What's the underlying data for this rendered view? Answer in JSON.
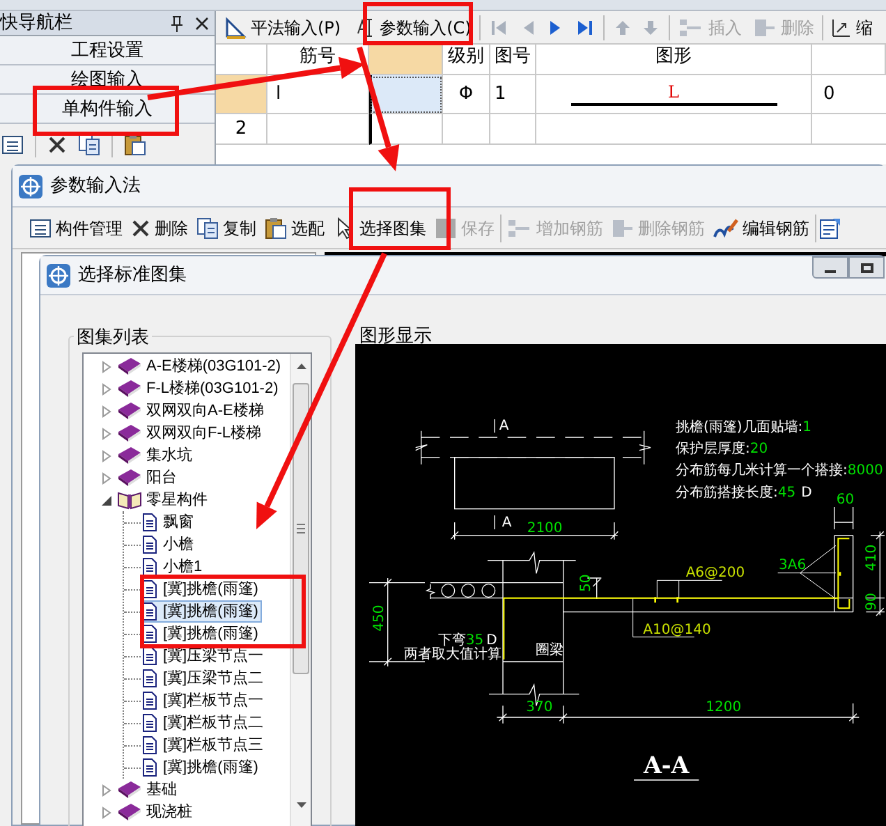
{
  "nav_panel": {
    "title": "快导航栏",
    "items": [
      {
        "label": "工程设置"
      },
      {
        "label": "绘图输入"
      },
      {
        "label": "单构件输入"
      }
    ]
  },
  "main_toolbar": {
    "buttons": [
      {
        "label": "平法输入(P)",
        "disabled": false
      },
      {
        "label": "参数输入(C)",
        "disabled": false
      },
      {
        "label": "插入",
        "disabled": true
      },
      {
        "label": "删除",
        "disabled": true
      },
      {
        "label": "缩",
        "disabled": false
      }
    ]
  },
  "grid": {
    "columns": [
      "筋号",
      "级别",
      "图号",
      "图形"
    ],
    "rows": [
      {
        "selected": true,
        "bar_no": "l",
        "grade": "Φ",
        "figure_no": "1",
        "shape_label": "L",
        "column_7": "0"
      },
      {
        "selected": false,
        "number": "2"
      }
    ]
  },
  "param_window": {
    "title": "参数输入法",
    "toolbar": [
      {
        "label": "构件管理",
        "disabled": false
      },
      {
        "label": "删除",
        "disabled": false
      },
      {
        "label": "复制",
        "disabled": false
      },
      {
        "label": "选配",
        "disabled": false
      },
      {
        "label": "选择图集",
        "disabled": false
      },
      {
        "label": "保存",
        "disabled": true
      },
      {
        "label": "增加钢筋",
        "disabled": true
      },
      {
        "label": "删除钢筋",
        "disabled": true
      },
      {
        "label": "编辑钢筋",
        "disabled": false
      }
    ]
  },
  "dialog": {
    "title": "选择标准图集",
    "list_title": "图集列表",
    "preview_title": "图形显示",
    "tree": [
      {
        "label": "A-E楼梯(03G101-2)",
        "kind": "book",
        "expanded": false,
        "selected": false
      },
      {
        "label": "F-L楼梯(03G101-2)",
        "kind": "book",
        "expanded": false,
        "selected": false
      },
      {
        "label": "双网双向A-E楼梯",
        "kind": "book",
        "expanded": false,
        "selected": false
      },
      {
        "label": "双网双向F-L楼梯",
        "kind": "book",
        "expanded": false,
        "selected": false
      },
      {
        "label": "集水坑",
        "kind": "book",
        "expanded": false,
        "selected": false
      },
      {
        "label": "阳台",
        "kind": "book",
        "expanded": false,
        "selected": false
      },
      {
        "label": "零星构件",
        "kind": "book",
        "expanded": true,
        "selected": false,
        "children": [
          {
            "label": "飘窗",
            "kind": "page",
            "selected": false
          },
          {
            "label": "小檐",
            "kind": "page",
            "selected": false
          },
          {
            "label": "小檐1",
            "kind": "page",
            "selected": false
          },
          {
            "label": "[冀]挑檐(雨篷)",
            "kind": "page",
            "selected": false
          },
          {
            "label": "[冀]挑檐(雨篷)",
            "kind": "page",
            "selected": true
          },
          {
            "label": "[冀]挑檐(雨篷)",
            "kind": "page",
            "selected": false
          },
          {
            "label": "[冀]压梁节点一",
            "kind": "page",
            "selected": false
          },
          {
            "label": "[冀]压梁节点二",
            "kind": "page",
            "selected": false
          },
          {
            "label": "[冀]栏板节点一",
            "kind": "page",
            "selected": false
          },
          {
            "label": "[冀]栏板节点二",
            "kind": "page",
            "selected": false
          },
          {
            "label": "[冀]栏板节点三",
            "kind": "page",
            "selected": false
          },
          {
            "label": "[冀]挑檐(雨篷)",
            "kind": "page",
            "selected": false
          }
        ]
      },
      {
        "label": "基础",
        "kind": "book",
        "expanded": false,
        "selected": false
      },
      {
        "label": "现浇桩",
        "kind": "book",
        "expanded": false,
        "selected": false
      }
    ],
    "drawing": {
      "notes": [
        {
          "label": "挑檐(雨篷)几面贴墙:",
          "value": "1"
        },
        {
          "label": "保护层厚度:",
          "value": "20"
        },
        {
          "label": "分布筋每几米计算一个搭接:",
          "value": "8000"
        },
        {
          "label": "分布筋搭接长度:",
          "value": "45",
          "unit": "D"
        }
      ],
      "labels": [
        {
          "text": "A",
          "color": "#ffffff"
        },
        {
          "text": "A",
          "color": "#ffffff"
        },
        {
          "text": "2100",
          "color": "#00e000"
        },
        {
          "text": "50",
          "color": "#00e000"
        },
        {
          "text": "A6@200",
          "color": "#c8e000"
        },
        {
          "text": "3A6",
          "color": "#00e000"
        },
        {
          "text": "60",
          "color": "#00e000"
        },
        {
          "text": "410",
          "color": "#00e000"
        },
        {
          "text": "90",
          "color": "#00e000"
        },
        {
          "text": "450",
          "color": "#00e000"
        },
        {
          "text": "A10@140",
          "color": "#c8e000"
        },
        {
          "text": "圈梁",
          "color": "#ffffff"
        },
        {
          "text": "370",
          "color": "#00e000"
        },
        {
          "text": "1200",
          "color": "#00e000"
        },
        {
          "text": "两者取大值计算",
          "color": "#ffffff"
        }
      ],
      "bend_note": {
        "label": "下弯",
        "value": "35",
        "unit": "D"
      },
      "title": "A-A"
    }
  }
}
